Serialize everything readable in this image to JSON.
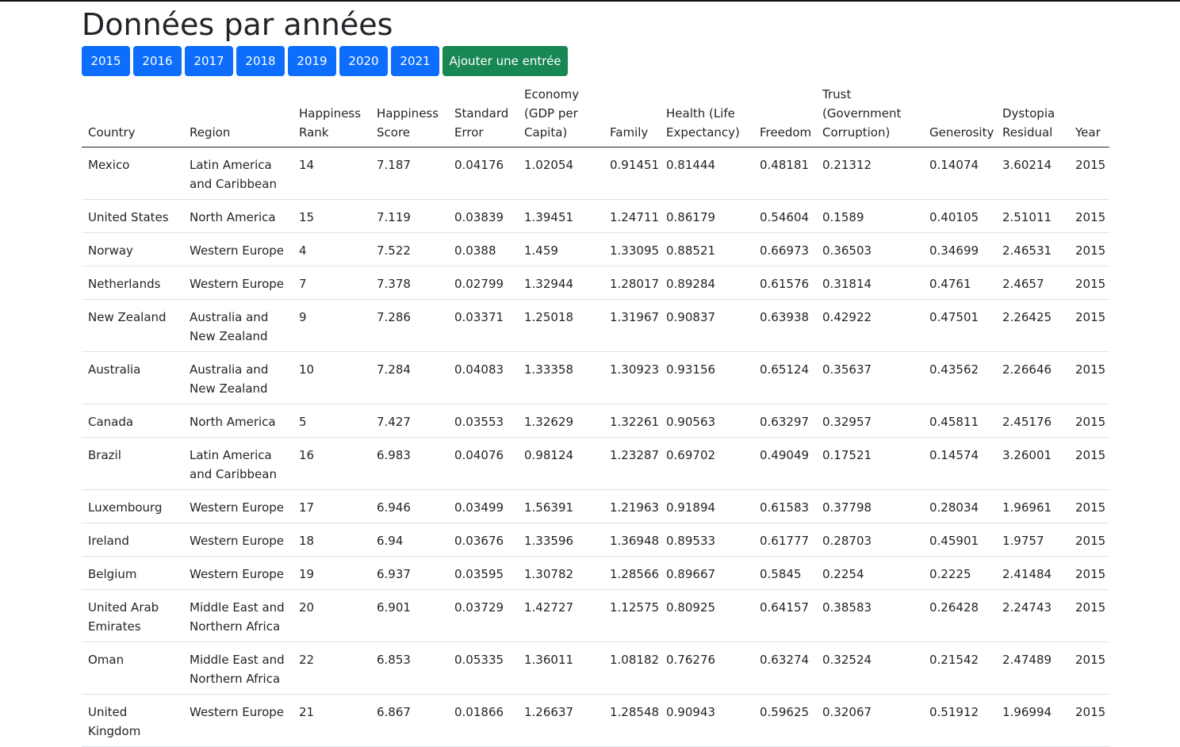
{
  "page": {
    "title": "Données par années",
    "year_buttons": [
      "2015",
      "2016",
      "2017",
      "2018",
      "2019",
      "2020",
      "2021"
    ],
    "add_button": "Ajouter une entrée"
  },
  "colors": {
    "primary": "#0d6efd",
    "success": "#198754"
  },
  "table": {
    "headers": [
      "Country",
      "Region",
      "Happiness Rank",
      "Happiness Score",
      "Standard Error",
      "Economy (GDP per Capita)",
      "Family",
      "Health (Life Expectancy)",
      "Freedom",
      "Trust (Government Corruption)",
      "Generosity",
      "Dystopia Residual",
      "Year"
    ],
    "rows": [
      [
        "Mexico",
        "Latin America and Caribbean",
        "14",
        "7.187",
        "0.04176",
        "1.02054",
        "0.91451",
        "0.81444",
        "0.48181",
        "0.21312",
        "0.14074",
        "3.60214",
        "2015"
      ],
      [
        "United States",
        "North America",
        "15",
        "7.119",
        "0.03839",
        "1.39451",
        "1.24711",
        "0.86179",
        "0.54604",
        "0.1589",
        "0.40105",
        "2.51011",
        "2015"
      ],
      [
        "Norway",
        "Western Europe",
        "4",
        "7.522",
        "0.0388",
        "1.459",
        "1.33095",
        "0.88521",
        "0.66973",
        "0.36503",
        "0.34699",
        "2.46531",
        "2015"
      ],
      [
        "Netherlands",
        "Western Europe",
        "7",
        "7.378",
        "0.02799",
        "1.32944",
        "1.28017",
        "0.89284",
        "0.61576",
        "0.31814",
        "0.4761",
        "2.4657",
        "2015"
      ],
      [
        "New Zealand",
        "Australia and New Zealand",
        "9",
        "7.286",
        "0.03371",
        "1.25018",
        "1.31967",
        "0.90837",
        "0.63938",
        "0.42922",
        "0.47501",
        "2.26425",
        "2015"
      ],
      [
        "Australia",
        "Australia and New Zealand",
        "10",
        "7.284",
        "0.04083",
        "1.33358",
        "1.30923",
        "0.93156",
        "0.65124",
        "0.35637",
        "0.43562",
        "2.26646",
        "2015"
      ],
      [
        "Canada",
        "North America",
        "5",
        "7.427",
        "0.03553",
        "1.32629",
        "1.32261",
        "0.90563",
        "0.63297",
        "0.32957",
        "0.45811",
        "2.45176",
        "2015"
      ],
      [
        "Brazil",
        "Latin America and Caribbean",
        "16",
        "6.983",
        "0.04076",
        "0.98124",
        "1.23287",
        "0.69702",
        "0.49049",
        "0.17521",
        "0.14574",
        "3.26001",
        "2015"
      ],
      [
        "Luxembourg",
        "Western Europe",
        "17",
        "6.946",
        "0.03499",
        "1.56391",
        "1.21963",
        "0.91894",
        "0.61583",
        "0.37798",
        "0.28034",
        "1.96961",
        "2015"
      ],
      [
        "Ireland",
        "Western Europe",
        "18",
        "6.94",
        "0.03676",
        "1.33596",
        "1.36948",
        "0.89533",
        "0.61777",
        "0.28703",
        "0.45901",
        "1.9757",
        "2015"
      ],
      [
        "Belgium",
        "Western Europe",
        "19",
        "6.937",
        "0.03595",
        "1.30782",
        "1.28566",
        "0.89667",
        "0.5845",
        "0.2254",
        "0.2225",
        "2.41484",
        "2015"
      ],
      [
        "United Arab Emirates",
        "Middle East and Northern Africa",
        "20",
        "6.901",
        "0.03729",
        "1.42727",
        "1.12575",
        "0.80925",
        "0.64157",
        "0.38583",
        "0.26428",
        "2.24743",
        "2015"
      ],
      [
        "Oman",
        "Middle East and Northern Africa",
        "22",
        "6.853",
        "0.05335",
        "1.36011",
        "1.08182",
        "0.76276",
        "0.63274",
        "0.32524",
        "0.21542",
        "2.47489",
        "2015"
      ],
      [
        "United Kingdom",
        "Western Europe",
        "21",
        "6.867",
        "0.01866",
        "1.26637",
        "1.28548",
        "0.90943",
        "0.59625",
        "0.32067",
        "0.51912",
        "1.96994",
        "2015"
      ]
    ]
  }
}
